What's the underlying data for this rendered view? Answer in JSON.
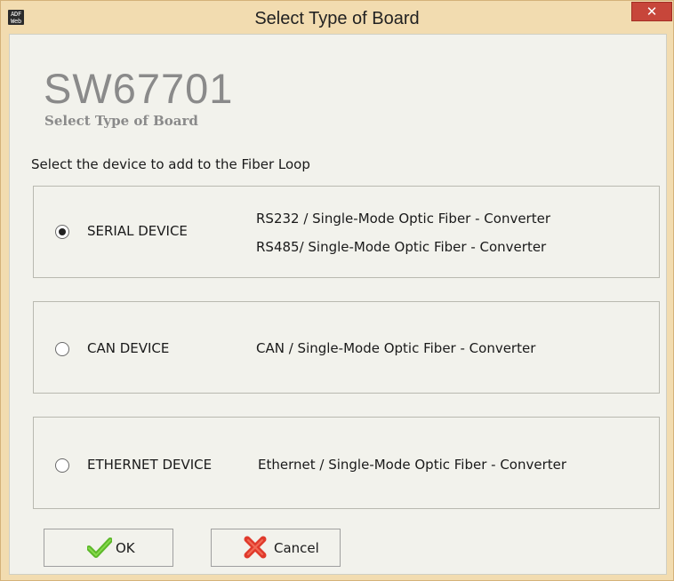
{
  "window": {
    "title": "Select Type of Board",
    "app_icon_text": "ADF\nWeb",
    "close_glyph": "✕"
  },
  "header": {
    "brand": "SW67701",
    "subtitle": "Select Type of Board"
  },
  "instruction": "Select the device to add to the Fiber Loop",
  "devices": [
    {
      "name": "SERIAL DEVICE",
      "selected": true,
      "descriptions": [
        "RS232 / Single-Mode Optic Fiber - Converter",
        "RS485/ Single-Mode Optic Fiber - Converter"
      ]
    },
    {
      "name": "CAN DEVICE",
      "selected": false,
      "descriptions": [
        "CAN / Single-Mode Optic Fiber - Converter"
      ]
    },
    {
      "name": "ETHERNET DEVICE",
      "selected": false,
      "descriptions": [
        "Ethernet  / Single-Mode Optic Fiber - Converter"
      ]
    }
  ],
  "buttons": {
    "ok": {
      "label": "OK",
      "icon": "check-icon"
    },
    "cancel": {
      "label": "Cancel",
      "icon": "cross-icon"
    }
  },
  "colors": {
    "titlebar": "#f2dcb0",
    "close": "#c7463a",
    "ok_icon": "#5cb829",
    "cancel_icon": "#e03a2c"
  }
}
